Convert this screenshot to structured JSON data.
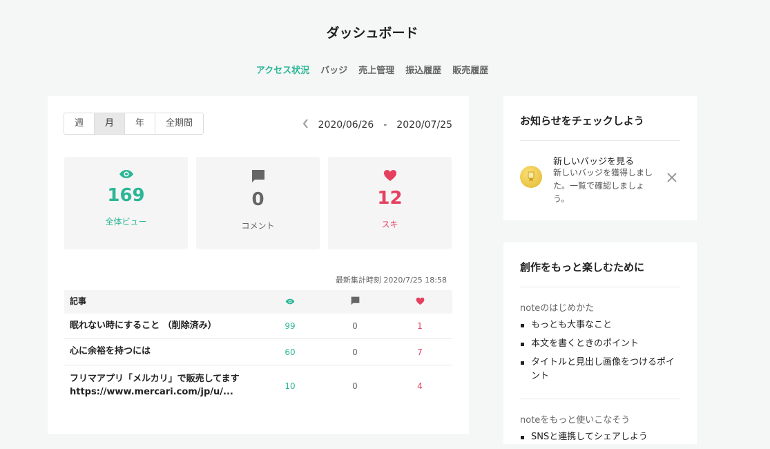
{
  "page": {
    "title": "ダッシュボード"
  },
  "tabs": [
    {
      "label": "アクセス状況",
      "active": true
    },
    {
      "label": "バッジ"
    },
    {
      "label": "売上管理"
    },
    {
      "label": "振込履歴"
    },
    {
      "label": "販売履歴"
    }
  ],
  "period": {
    "options": [
      "週",
      "月",
      "年",
      "全期間"
    ],
    "selected": "月"
  },
  "date_range": {
    "start": "2020/06/26",
    "separator": "-",
    "end": "2020/07/25"
  },
  "stats": {
    "views": {
      "value": "169",
      "label": "全体ビュー",
      "icon": "eye-icon"
    },
    "comments": {
      "value": "0",
      "label": "コメント",
      "icon": "comment-icon"
    },
    "likes": {
      "value": "12",
      "label": "スキ",
      "icon": "heart-icon"
    }
  },
  "updated": "最新集計時刻 2020/7/25 18:58",
  "table": {
    "header": {
      "article": "記事"
    },
    "rows": [
      {
        "title": "眠れない時にすること （削除済み）",
        "views": "99",
        "comments": "0",
        "likes": "1"
      },
      {
        "title": "心に余裕を持つには",
        "views": "60",
        "comments": "0",
        "likes": "7"
      },
      {
        "title": "フリマアプリ「メルカリ」で販売してます https://www.mercari.com/jp/u/...",
        "views": "10",
        "comments": "0",
        "likes": "4"
      }
    ]
  },
  "notice": {
    "title": "お知らせをチェックしよう",
    "item_title": "新しいバッジを見る",
    "item_body": "新しいバッジを獲得しました。一覧で確認しましょう。"
  },
  "guide": {
    "title": "創作をもっと楽しむために",
    "sections": [
      {
        "heading": "noteのはじめかた",
        "items": [
          "もっとも大事なこと",
          "本文を書くときのポイント",
          "タイトルと見出し画像をつけるポイント"
        ]
      },
      {
        "heading": "noteをもっと使いこなそう",
        "items": [
          "SNSと連携してシェアしよう"
        ]
      }
    ]
  },
  "colors": {
    "accent": "#2cb696",
    "like": "#e64060",
    "muted": "#666666"
  }
}
